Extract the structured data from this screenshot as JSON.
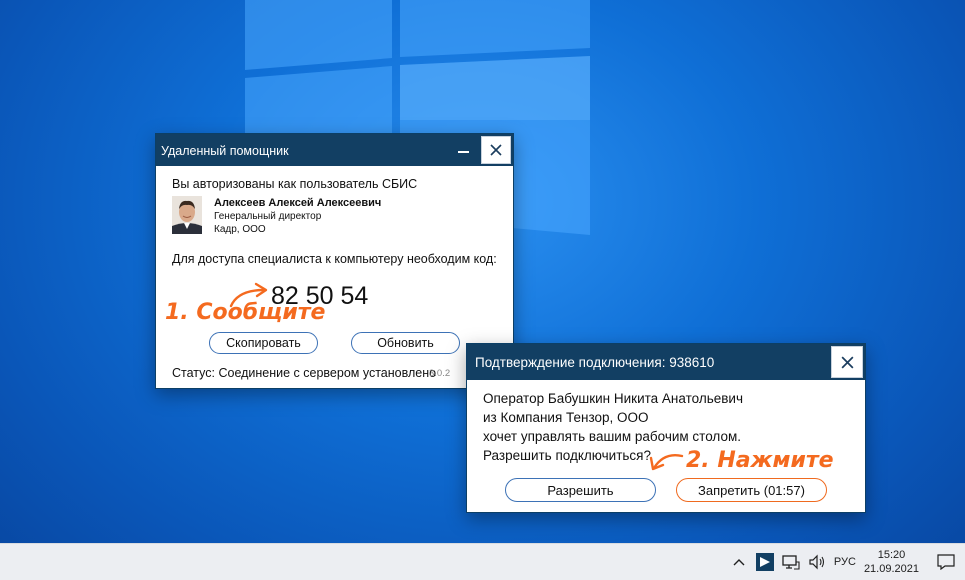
{
  "helper": {
    "title": "Удаленный помощник",
    "authorized_text": "Вы авторизованы как пользователь СБИС",
    "user_name": "Алексеев Алексей Алексеевич",
    "user_position": "Генеральный директор",
    "user_company": "Кадр, ООО",
    "code_prompt": "Для доступа специалиста к компьютеру необходим код:",
    "code": "82 50 54",
    "copy_label": "Скопировать",
    "refresh_label": "Обновить",
    "status": "Статус: Соединение с сервером установлено",
    "version": "3.0.2"
  },
  "confirm": {
    "title": "Подтверждение подключения: 938610",
    "line1": "Оператор Бабушкин Никита Анатольевич",
    "line2": "из Компания Тензор, ООО",
    "line3": "хочет управлять вашим рабочим столом.",
    "line4": "Разрешить подключиться?",
    "allow_label": "Разрешить",
    "deny_label": "Запретить (01:57)"
  },
  "annotations": {
    "step1": "1. Сообщите",
    "step2": "2. Нажмите"
  },
  "taskbar": {
    "language": "РУС",
    "time": "15:20",
    "date": "21.09.2021"
  },
  "colors": {
    "titlebar": "#123f63",
    "accent_orange": "#f46a1f",
    "button_blue": "#3d72b6"
  }
}
